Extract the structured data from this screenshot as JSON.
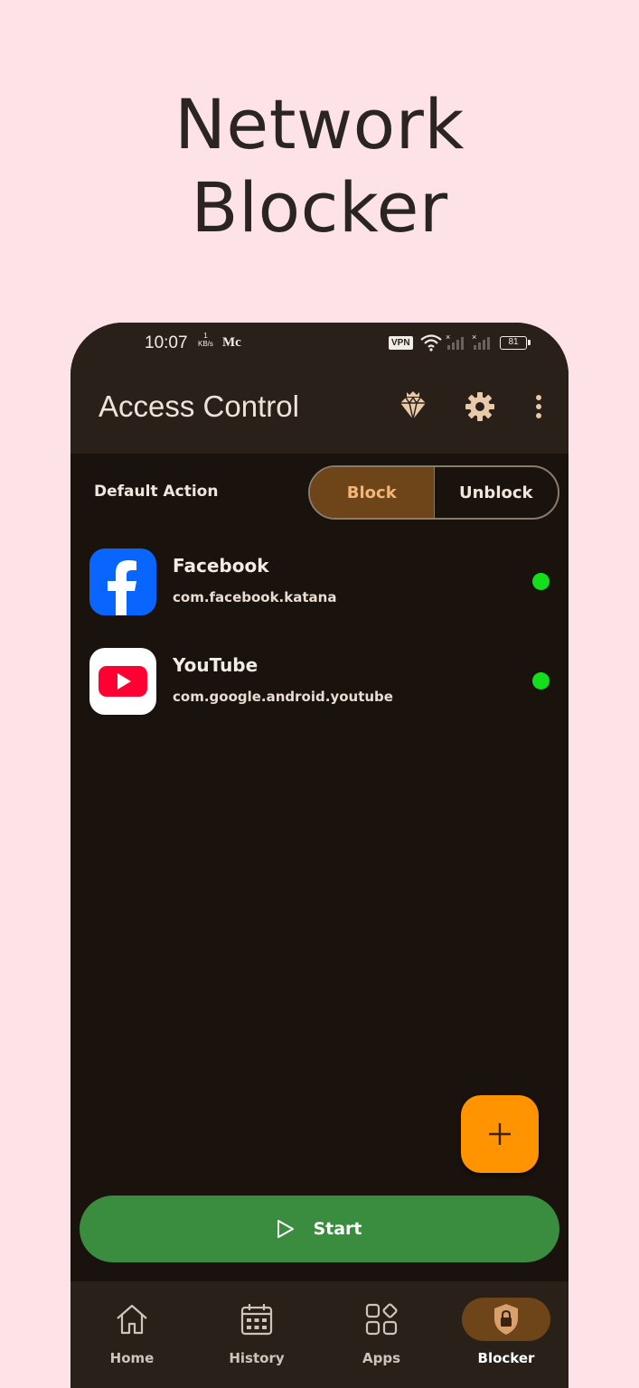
{
  "promo": {
    "title_line1": "Network",
    "title_line2": "Blocker"
  },
  "status_bar": {
    "time": "10:07",
    "speed_value": "1",
    "speed_unit": "KB/s",
    "carrier": "Mc",
    "vpn": "VPN",
    "battery": "81"
  },
  "appbar": {
    "title": "Access Control",
    "icons": [
      "diamond-icon",
      "gear-icon",
      "more-vert-icon"
    ]
  },
  "default_action": {
    "label": "Default Action",
    "options": [
      "Block",
      "Unblock"
    ],
    "selected": "Block"
  },
  "apps": [
    {
      "name": "Facebook",
      "package": "com.facebook.katana",
      "icon": "facebook-icon",
      "status_color": "#11e01a"
    },
    {
      "name": "YouTube",
      "package": "com.google.android.youtube",
      "icon": "youtube-icon",
      "status_color": "#11e01a"
    }
  ],
  "fab": {
    "icon": "plus-icon"
  },
  "start_button": {
    "label": "Start",
    "icon": "play-icon"
  },
  "bottom_nav": {
    "items": [
      {
        "label": "Home",
        "icon": "home-icon"
      },
      {
        "label": "History",
        "icon": "calendar-icon"
      },
      {
        "label": "Apps",
        "icon": "apps-icon"
      },
      {
        "label": "Blocker",
        "icon": "lock-shield-icon"
      }
    ],
    "active": "Blocker"
  },
  "colors": {
    "page_background": "#fde3e8",
    "phone_background": "#1a120d",
    "bar_background": "#2a201a",
    "accent_brown": "#6d4518",
    "accent_orange": "#ff9300",
    "start_green": "#3a8c3e",
    "status_green": "#11e01a"
  }
}
